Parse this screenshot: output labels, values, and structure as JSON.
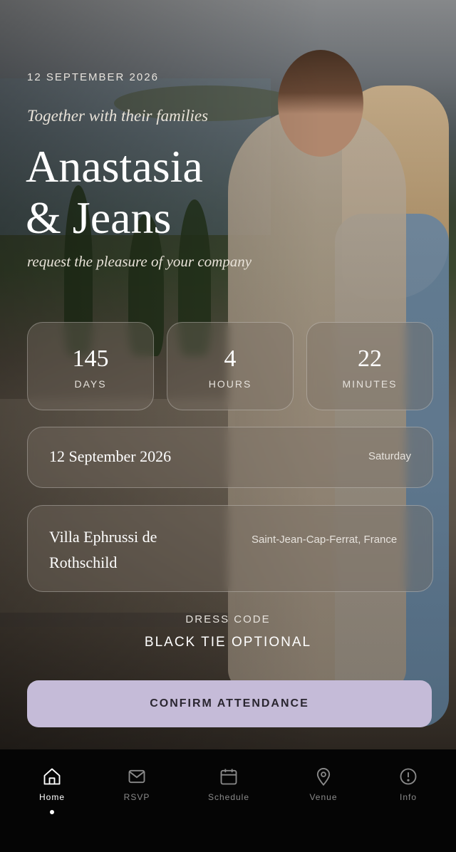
{
  "hero": {
    "date": "12 SEPTEMBER 2026",
    "intro": "Together with their families",
    "name_line1": "Anastasia",
    "name_line2": "& Jeans",
    "request": "request the pleasure of your company"
  },
  "countdown": [
    {
      "value": "145",
      "unit": "DAYS"
    },
    {
      "value": "4",
      "unit": "HOURS"
    },
    {
      "value": "22",
      "unit": "MINUTES"
    }
  ],
  "date_card": {
    "date": "12 September 2026",
    "weekday": "Saturday"
  },
  "venue_card": {
    "name": "Villa Ephrussi de Rothschild",
    "location": "Saint-Jean-Cap-Ferrat, France"
  },
  "dress_code": {
    "label": "DRESS CODE",
    "value": "BLACK TIE OPTIONAL"
  },
  "confirm_label": "CONFIRM ATTENDANCE",
  "colors": {
    "accent": "#c5bbd8",
    "nav_bg": "#050505"
  },
  "nav": [
    {
      "label": "Home",
      "icon": "home-icon",
      "active": true
    },
    {
      "label": "RSVP",
      "icon": "mail-icon"
    },
    {
      "label": "Schedule",
      "icon": "calendar-icon"
    },
    {
      "label": "Venue",
      "icon": "location-pin-icon"
    },
    {
      "label": "Info",
      "icon": "info-icon"
    }
  ]
}
